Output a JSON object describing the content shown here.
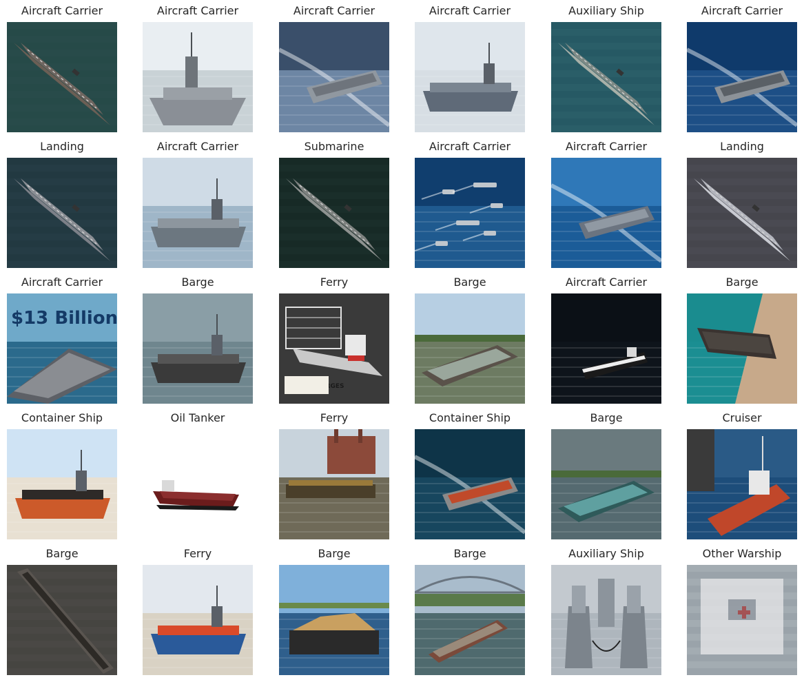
{
  "panels": [
    {
      "label": "Aircraft Carrier",
      "scene": "aerial",
      "sky": "#2f4f4f",
      "water": "#264a48",
      "hull": "#6b5f55",
      "deck": "#6f6660",
      "overlay_text": ""
    },
    {
      "label": "Aircraft Carrier",
      "scene": "front",
      "sky": "#e9eef2",
      "water": "#c9d2d6",
      "hull": "#8a8f96",
      "deck": "#9aa0a6",
      "overlay_text": ""
    },
    {
      "label": "Aircraft Carrier",
      "scene": "wake",
      "sky": "#3a4f6a",
      "water": "#6d86a4",
      "hull": "#9098a0",
      "deck": "#6e747c",
      "overlay_text": ""
    },
    {
      "label": "Aircraft Carrier",
      "scene": "side",
      "sky": "#dfe6ec",
      "water": "#d7dee4",
      "hull": "#5f6a78",
      "deck": "#7a8591",
      "overlay_text": ""
    },
    {
      "label": "Auxiliary Ship",
      "scene": "aerial",
      "sky": "#1c4a56",
      "water": "#2a5e68",
      "hull": "#a8b0a8",
      "deck": "#7e8a86",
      "overlay_text": ""
    },
    {
      "label": "Aircraft Carrier",
      "scene": "wake",
      "sky": "#0f3a6b",
      "water": "#1d4f86",
      "hull": "#8c9298",
      "deck": "#5a6066",
      "overlay_text": ""
    },
    {
      "label": "Landing",
      "scene": "aerial",
      "sky": "#1d2e36",
      "water": "#253c45",
      "hull": "#7c8088",
      "deck": "#8a8e94",
      "overlay_text": ""
    },
    {
      "label": "Aircraft Carrier",
      "scene": "side",
      "sky": "#cfdbe6",
      "water": "#9fb6c8",
      "hull": "#6c7780",
      "deck": "#8d969e",
      "overlay_text": ""
    },
    {
      "label": "Submarine",
      "scene": "aerial",
      "sky": "#0e1f1c",
      "water": "#1a2e2a",
      "hull": "#8e9290",
      "deck": "#7d817f",
      "overlay_text": ""
    },
    {
      "label": "Aircraft Carrier",
      "scene": "fleet",
      "sky": "#103e6e",
      "water": "#1f5a8f",
      "hull": "#c0c6cc",
      "deck": "#9aa0a6",
      "overlay_text": ""
    },
    {
      "label": "Aircraft Carrier",
      "scene": "wake",
      "sky": "#2f78b8",
      "water": "#1b5c98",
      "hull": "#6b7480",
      "deck": "#9099a3",
      "overlay_text": ""
    },
    {
      "label": "Landing",
      "scene": "aerial",
      "sky": "#3a3a40",
      "water": "#4a4a52",
      "hull": "#c9cbd2",
      "deck": "#b3b5bd",
      "overlay_text": ""
    },
    {
      "label": "Aircraft Carrier",
      "scene": "billion",
      "sky": "#6fa9c9",
      "water": "#2b6a8c",
      "hull": "#5d6066",
      "deck": "#8a8d92",
      "overlay_text": "$13 Billion"
    },
    {
      "label": "Barge",
      "scene": "side",
      "sky": "#8a9ea6",
      "water": "#6f868e",
      "hull": "#3a3a3a",
      "deck": "#555555",
      "overlay_text": ""
    },
    {
      "label": "Ferry",
      "scene": "barges",
      "sky": "#3a3a3a",
      "water": "#7a7a7a",
      "hull": "#c9c9c9",
      "deck": "#e2e2e2",
      "overlay_text": "INLAND BARGES"
    },
    {
      "label": "Barge",
      "scene": "river",
      "sky": "#b7cfe3",
      "water": "#6d7b62",
      "hull": "#5a524a",
      "deck": "#9aa79c",
      "overlay_text": ""
    },
    {
      "label": "Aircraft Carrier",
      "scene": "dark",
      "sky": "#0b1016",
      "water": "#0e141b",
      "hull": "#1a1a1a",
      "deck": "#d9d9d9",
      "overlay_text": ""
    },
    {
      "label": "Barge",
      "scene": "dock",
      "sky": "#1a8c8f",
      "water": "#1b8e92",
      "hull": "#3a3330",
      "deck": "#4b4540",
      "overlay_text": ""
    },
    {
      "label": "Container Ship",
      "scene": "orange",
      "sky": "#cfe3f4",
      "water": "#e8e0d2",
      "hull": "#cc5a2a",
      "deck": "#2e2a28",
      "overlay_text": ""
    },
    {
      "label": "Oil Tanker",
      "scene": "white",
      "sky": "#ffffff",
      "water": "#ffffff",
      "hull": "#6b1c1c",
      "deck": "#8b2e2e",
      "overlay_text": ""
    },
    {
      "label": "Ferry",
      "scene": "factory",
      "sky": "#c8d3dc",
      "water": "#6f6a58",
      "hull": "#4a3f2a",
      "deck": "#9a7a3a",
      "overlay_text": ""
    },
    {
      "label": "Container Ship",
      "scene": "wake",
      "sky": "#0e3448",
      "water": "#17465e",
      "hull": "#8a8a8a",
      "deck": "#c04a2a",
      "overlay_text": ""
    },
    {
      "label": "Barge",
      "scene": "river",
      "sky": "#6a7a7e",
      "water": "#556a70",
      "hull": "#2f5a5a",
      "deck": "#5fa0a0",
      "overlay_text": ""
    },
    {
      "label": "Cruiser",
      "scene": "rig",
      "sky": "#2a5a86",
      "water": "#1d4d7a",
      "hull": "#c0472a",
      "deck": "#e8e8e8",
      "overlay_text": ""
    },
    {
      "label": "Barge",
      "scene": "satellite",
      "sky": "#3b3a38",
      "water": "#4a4845",
      "hull": "#2d2a26",
      "deck": "#5a5550",
      "overlay_text": ""
    },
    {
      "label": "Ferry",
      "scene": "bluehull",
      "sky": "#e3e8ee",
      "water": "#d9d2c4",
      "hull": "#2a5a9a",
      "deck": "#d94a2a",
      "overlay_text": ""
    },
    {
      "label": "Barge",
      "scene": "sand",
      "sky": "#7fb0da",
      "water": "#2f5f8c",
      "hull": "#2a2a2a",
      "deck": "#c9a060",
      "overlay_text": ""
    },
    {
      "label": "Barge",
      "scene": "bridge",
      "sky": "#a9bccc",
      "water": "#4f6a6e",
      "hull": "#7a4a3a",
      "deck": "#9a8a7a",
      "overlay_text": ""
    },
    {
      "label": "Auxiliary Ship",
      "scene": "twin",
      "sky": "#c3c9cf",
      "water": "#aeb6bd",
      "hull": "#7c848c",
      "deck": "#9aa2aa",
      "overlay_text": ""
    },
    {
      "label": "Other Warship",
      "scene": "blur",
      "sky": "#bfc6cc",
      "water": "#9aa3aa",
      "hull": "#e8e8ea",
      "deck": "#6a7580",
      "overlay_text": ""
    }
  ]
}
